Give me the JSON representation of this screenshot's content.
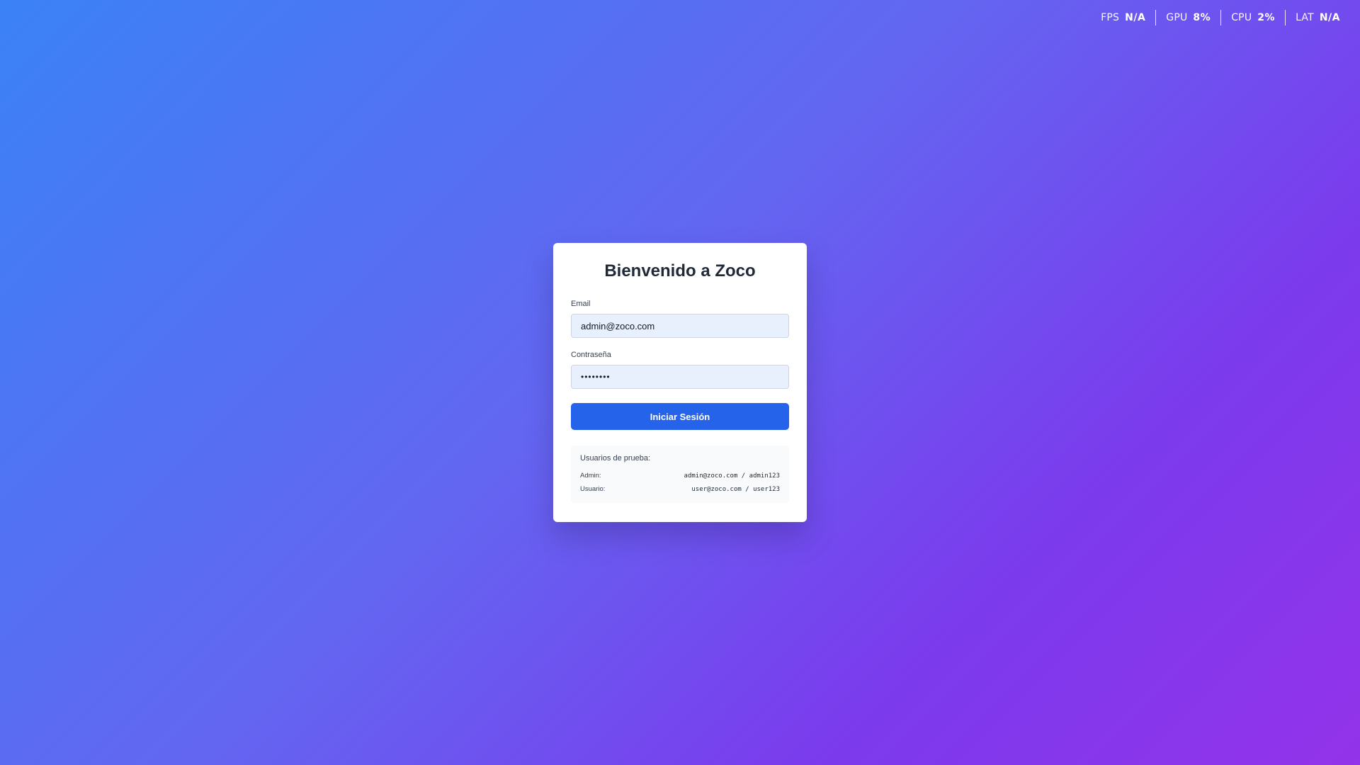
{
  "perf_overlay": {
    "items": [
      {
        "label": "FPS",
        "value": "N/A"
      },
      {
        "label": "GPU",
        "value": "8%"
      },
      {
        "label": "CPU",
        "value": "2%"
      },
      {
        "label": "LAT",
        "value": "N/A"
      }
    ]
  },
  "login": {
    "title": "Bienvenido a Zoco",
    "email_label": "Email",
    "email_value": "admin@zoco.com",
    "password_label": "Contraseña",
    "password_value": "admin123",
    "submit_label": "Iniciar Sesión"
  },
  "test_users": {
    "title": "Usuarios de prueba:",
    "rows": [
      {
        "role": "Admin:",
        "credentials": "admin@zoco.com / admin123"
      },
      {
        "role": "Usuario:",
        "credentials": "user@zoco.com / user123"
      }
    ]
  },
  "colors": {
    "background_start": "#3b82f6",
    "background_end": "#9333ea",
    "primary_button": "#2563eb",
    "input_background": "#e8f0fe"
  }
}
